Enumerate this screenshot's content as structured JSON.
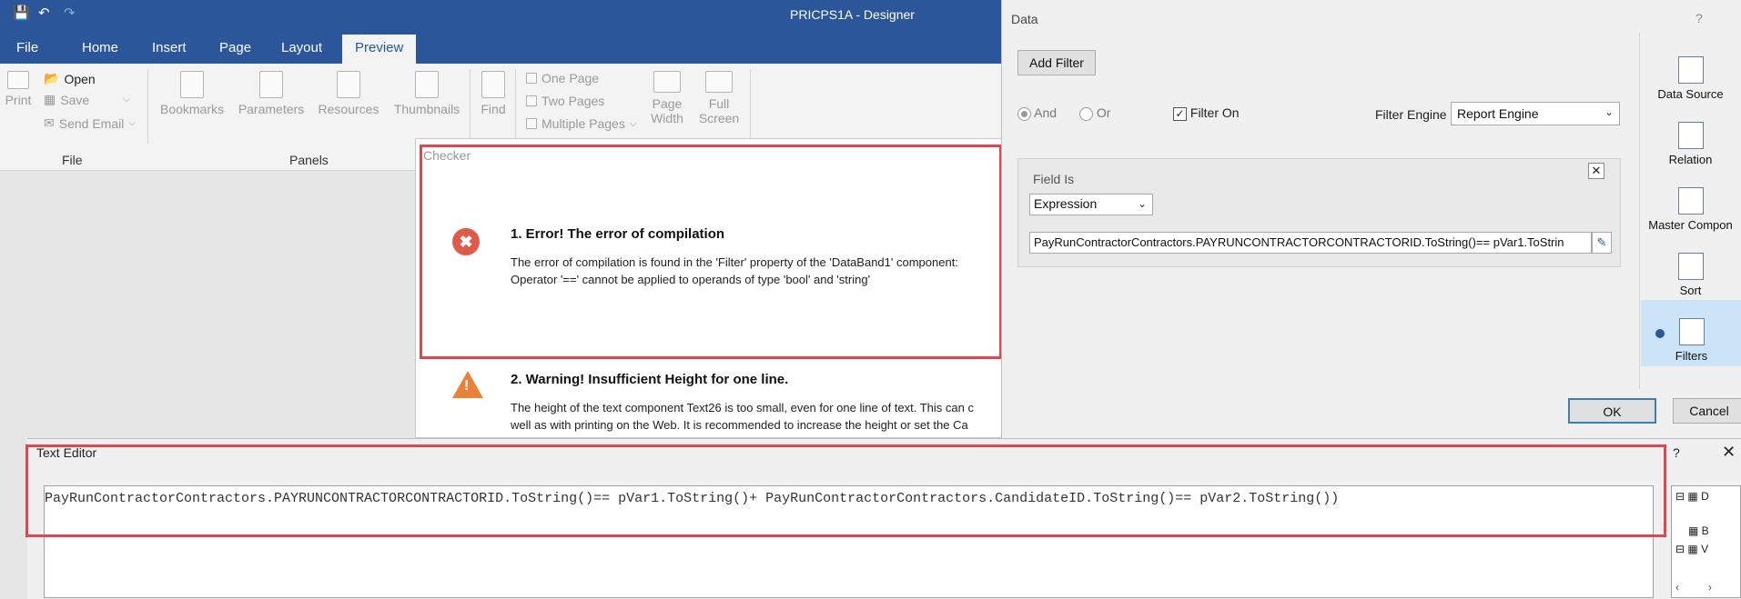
{
  "titlebar": {
    "title": "PRICPS1A - Designer",
    "save_icon": "save-icon",
    "undo_icon": "undo-icon",
    "redo_icon": "redo-icon"
  },
  "tabs": [
    {
      "label": "File"
    },
    {
      "label": "Home"
    },
    {
      "label": "Insert"
    },
    {
      "label": "Page"
    },
    {
      "label": "Layout"
    },
    {
      "label": "Preview"
    }
  ],
  "ribbon": {
    "print": "Print",
    "open": "Open",
    "save": "Save",
    "send_email": "Send Email",
    "group_file": "File",
    "bookmarks": "Bookmarks",
    "parameters": "Parameters",
    "resources": "Resources",
    "thumbnails": "Thumbnails",
    "group_panels": "Panels",
    "find": "Find",
    "one_page": "One Page",
    "two_pages": "Two Pages",
    "multiple_pages": "Multiple Pages",
    "page_width_1": "Page",
    "page_width_2": "Width",
    "full_screen_1": "Full",
    "full_screen_2": "Screen"
  },
  "checker": {
    "title": "Checker",
    "error_title": "1. Error! The error of compilation",
    "error_line1": "The error of compilation is found in the 'Filter' property of the 'DataBand1' component:",
    "error_line2": "Operator '==' cannot be applied to operands of type 'bool' and 'string'",
    "warning_title": "2. Warning! Insufficient Height for one line.",
    "warning_line1": "The height of the text component Text26 is too small, even for one line of text. This can c",
    "warning_line2": "well as with printing on the Web. It is recommended to increase the height or set the Ca"
  },
  "data_dialog": {
    "title": "Data",
    "help": "?",
    "add_filter": "Add Filter",
    "and_label": "And",
    "or_label": "Or",
    "filter_on_label": "Filter On",
    "filter_on_checked": true,
    "filter_engine_label": "Filter Engine",
    "filter_engine_value": "Report Engine",
    "field_is_label": "Field Is",
    "field_is_value": "Expression",
    "expression": "PayRunContractorContractors.PAYRUNCONTRACTORCONTRACTORID.ToString()== pVar1.ToStrin",
    "ok": "OK",
    "cancel": "Cancel",
    "side_items": [
      {
        "label": "Data Source"
      },
      {
        "label": "Relation"
      },
      {
        "label": "Master Compon"
      },
      {
        "label": "Sort"
      },
      {
        "label": "Filters"
      }
    ]
  },
  "text_editor": {
    "title": "Text Editor",
    "help": "?",
    "content": "PayRunContractorContractors.PAYRUNCONTRACTORCONTRACTORID.ToString()== pVar1.ToString()+ PayRunContractorContractors.CandidateID.ToString()== pVar2.ToString())",
    "tree_items": [
      {
        "label": "D"
      },
      {
        "label": "B"
      },
      {
        "label": "V"
      }
    ]
  },
  "colors": {
    "accent": "#2b579a",
    "highlight": "#e0464d",
    "selected_side": "#cce4f7"
  }
}
